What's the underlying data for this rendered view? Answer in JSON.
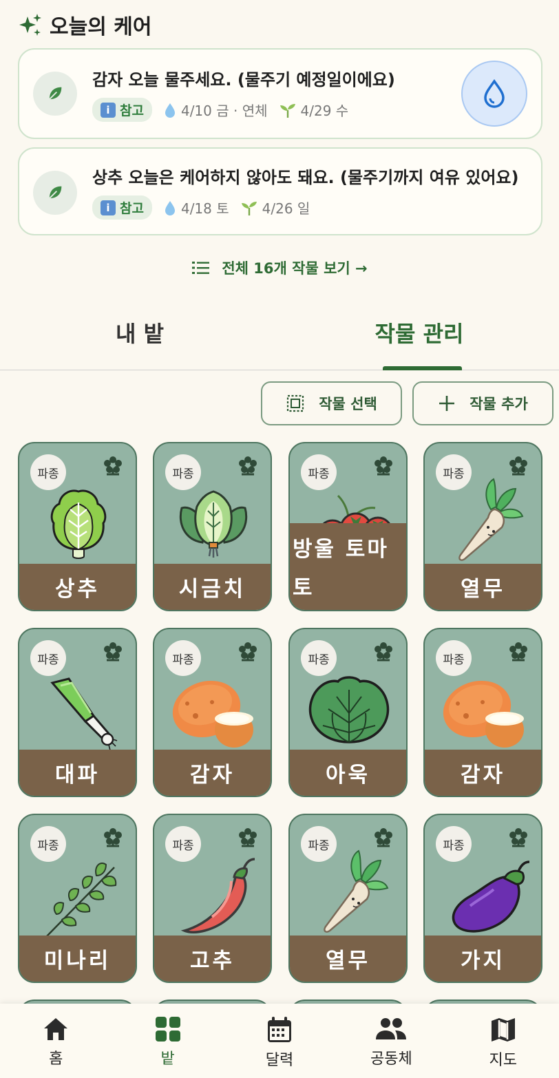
{
  "care": {
    "title": "오늘의 케어",
    "cards": [
      {
        "message": "감자 오늘 물주세요. (물주기 예정일이에요)",
        "chip": "참고",
        "water_date": "4/10 금 · 연체",
        "sprout_date": "4/29 수",
        "has_water_button": true
      },
      {
        "message": "상추 오늘은 케어하지 않아도 돼요. (물주기까지 여유 있어요)",
        "chip": "참고",
        "water_date": "4/18 토",
        "sprout_date": "4/26 일",
        "has_water_button": false
      }
    ],
    "view_all": "전체 16개 작물 보기 →"
  },
  "tabs": [
    {
      "label": "내 밭",
      "active": false
    },
    {
      "label": "작물 관리",
      "active": true
    }
  ],
  "actions": {
    "select_label": "작물 선택",
    "add_label": "작물 추가"
  },
  "crops": [
    {
      "name": "상추",
      "status": "파종",
      "icon": "lettuce-icon"
    },
    {
      "name": "시금치",
      "status": "파종",
      "icon": "spinach-icon"
    },
    {
      "name": "방울 토마토",
      "status": "파종",
      "icon": "cherry-tomato-icon"
    },
    {
      "name": "열무",
      "status": "파종",
      "icon": "young-radish-icon"
    },
    {
      "name": "대파",
      "status": "파종",
      "icon": "green-onion-icon"
    },
    {
      "name": "감자",
      "status": "파종",
      "icon": "potato-icon"
    },
    {
      "name": "아욱",
      "status": "파종",
      "icon": "mallow-icon"
    },
    {
      "name": "감자",
      "status": "파종",
      "icon": "potato-icon"
    },
    {
      "name": "미나리",
      "status": "파종",
      "icon": "water-parsley-icon"
    },
    {
      "name": "고추",
      "status": "파종",
      "icon": "chili-pepper-icon"
    },
    {
      "name": "열무",
      "status": "파종",
      "icon": "young-radish-icon"
    },
    {
      "name": "가지",
      "status": "파종",
      "icon": "eggplant-icon"
    }
  ],
  "nav": [
    {
      "label": "홈",
      "icon": "home-icon",
      "active": false
    },
    {
      "label": "밭",
      "icon": "grid-icon",
      "active": true
    },
    {
      "label": "달력",
      "icon": "calendar-icon",
      "active": false
    },
    {
      "label": "공동체",
      "icon": "people-icon",
      "active": false
    },
    {
      "label": "지도",
      "icon": "map-icon",
      "active": false
    }
  ],
  "colors": {
    "accent": "#2e6b34",
    "card_bg": "#93b4a4",
    "name_bar": "#7a6249",
    "page_bg": "#fbf8f0",
    "water_button": "#dce9fb"
  }
}
